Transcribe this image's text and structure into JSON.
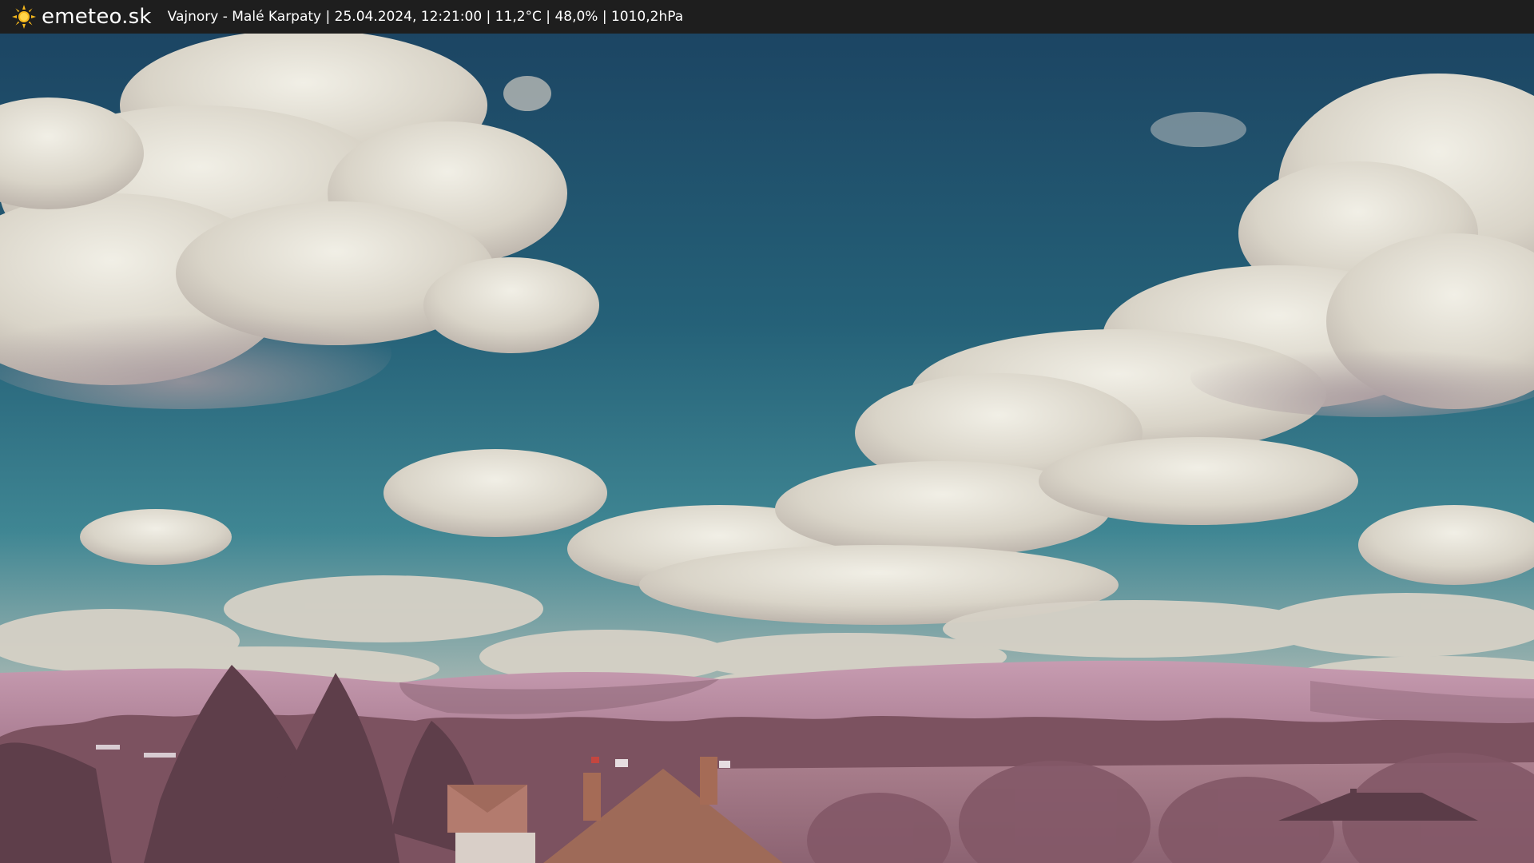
{
  "header": {
    "brand": "emeteo.sk",
    "status_line": "Vajnory - Malé Karpaty | 25.04.2024, 12:21:00 | 11,2°C | 48,0% | 1010,2hPa",
    "logo_icon": "sun-icon"
  },
  "colors": {
    "bar_background": "#1e1e1e",
    "sun_yellow": "#f5b81c",
    "sky_top": "#1d4a66",
    "sky_mid": "#2f7388",
    "hills_pink": "#b88a9f",
    "trees_dark": "#6f4a54"
  }
}
